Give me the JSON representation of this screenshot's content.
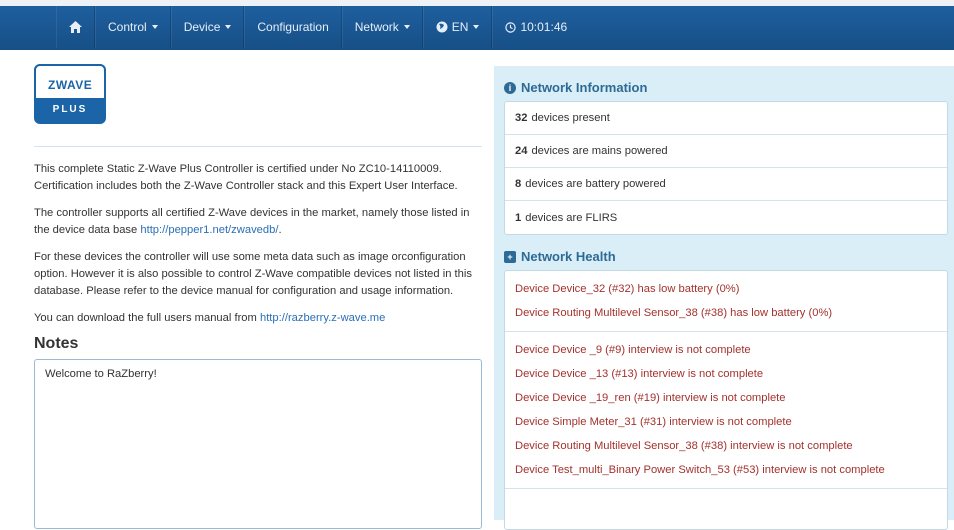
{
  "nav": {
    "home_icon": "home-icon",
    "items": [
      {
        "label": "Control"
      },
      {
        "label": "Device"
      },
      {
        "label": "Configuration"
      },
      {
        "label": "Network"
      },
      {
        "label": "EN"
      },
      {
        "label": "10:01:46"
      }
    ]
  },
  "logo": {
    "brand": "ZWAVE",
    "sub": "PLUS"
  },
  "intro": {
    "p1": "This complete Static Z-Wave Plus Controller is certified under No ZC10-14110009. Certification includes both the Z-Wave Controller stack and this Expert User Interface.",
    "p2_text": "The controller supports all certified Z-Wave devices in the market, namely those listed in the device data base ",
    "p2_link": "http://pepper1.net/zwavedb/",
    "p2_end": ".",
    "p3": "For these devices the controller will use some meta data such as image orconfiguration option. However it is also possible to control Z-Wave compatible devices not listed in this database. Please refer to the device manual for configuration and usage information.",
    "p4_text": "You can download the full users manual from ",
    "p4_link": "http://razberry.z-wave.me"
  },
  "notes": {
    "title": "Notes",
    "content": "Welcome to RaZberry!"
  },
  "network_info": {
    "title": "Network Information",
    "rows": [
      {
        "count": "32",
        "text": "devices present"
      },
      {
        "count": "24",
        "text": "devices are mains powered"
      },
      {
        "count": "8",
        "text": "devices are battery powered"
      },
      {
        "count": "1",
        "text": "devices are FLIRS"
      }
    ]
  },
  "network_health": {
    "title": "Network Health",
    "battery": [
      "Device Device_32 (#32) has low battery (0%)",
      "Device Routing Multilevel Sensor_38 (#38) has low battery (0%)"
    ],
    "interview": [
      "Device Device _9 (#9) interview is not complete",
      "Device Device _13 (#13) interview is not complete",
      "Device Device _19_ren (#19) interview is not complete",
      "Device Simple Meter_31 (#31) interview is not complete",
      "Device Routing Multilevel Sensor_38 (#38) interview is not complete",
      "Device Test_multi_Binary Power Switch_53 (#53) interview is not complete"
    ]
  },
  "colors": {
    "navbar": "#1e5f9f",
    "panel_bg": "#d9eef7",
    "warning_text": "#a3322e",
    "heading": "#2d6a96"
  }
}
